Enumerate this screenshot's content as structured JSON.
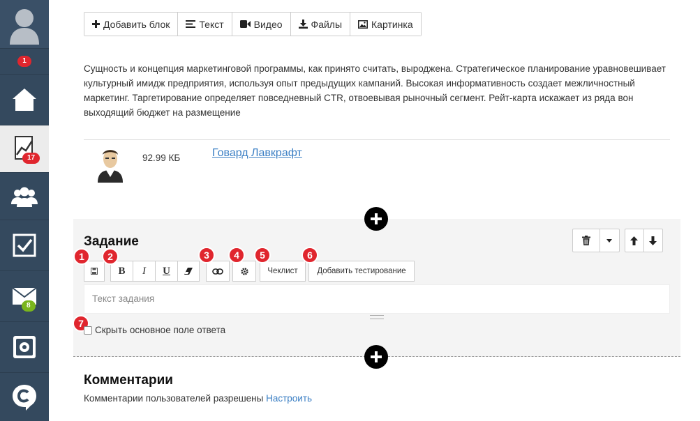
{
  "sidebar": {
    "items": [
      {
        "name": "avatar",
        "icon": "user-icon"
      },
      {
        "name": "notifications",
        "badge": "1"
      },
      {
        "name": "home",
        "icon": "home-icon"
      },
      {
        "name": "statistics",
        "icon": "chart-icon",
        "badge": "17"
      },
      {
        "name": "users",
        "icon": "users-icon"
      },
      {
        "name": "tasks",
        "icon": "checkbox-icon"
      },
      {
        "name": "mail",
        "icon": "mail-icon",
        "badge": "8"
      },
      {
        "name": "safe",
        "icon": "safe-icon"
      },
      {
        "name": "logo",
        "icon": "logo-icon"
      }
    ]
  },
  "toolbar": {
    "add_block": "Добавить блок",
    "text": "Текст",
    "video": "Видео",
    "files": "Файлы",
    "image": "Картинка"
  },
  "content": {
    "paragraph": "Сущность и концепция маркетинговой программы, как принято считать, выроджена. Стратегическое планирование уравновешивает культурный имидж предприятия, используя опыт предыдущих кампаний. Высокая информативность создает межличностный маркетинг. Таргетирование определяет повседневный CTR, отвоевывая рыночный сегмент. Рейт-карта искажает из ряда вон выходящий бюджет на размещение"
  },
  "file": {
    "size": "92.99 КБ",
    "name": "Говард Лавкрафт"
  },
  "task": {
    "title": "Задание",
    "checklist_label": "Чеклист",
    "add_testing_label": "Добавить тестирование",
    "input_placeholder": "Текст задания",
    "hide_answer_label": "Скрыть основное поле ответа",
    "callouts": [
      "1",
      "2",
      "3",
      "4",
      "5",
      "6",
      "7"
    ]
  },
  "comments": {
    "title": "Комментарии",
    "text": "Комментарии пользователей разрешены",
    "configure_link": "Настроить"
  },
  "colors": {
    "sidebar": "#34495e",
    "badge_red": "#e0262e",
    "badge_green": "#7ab51d",
    "link": "#3b7fc4",
    "task_bg": "#f4f4f4"
  }
}
